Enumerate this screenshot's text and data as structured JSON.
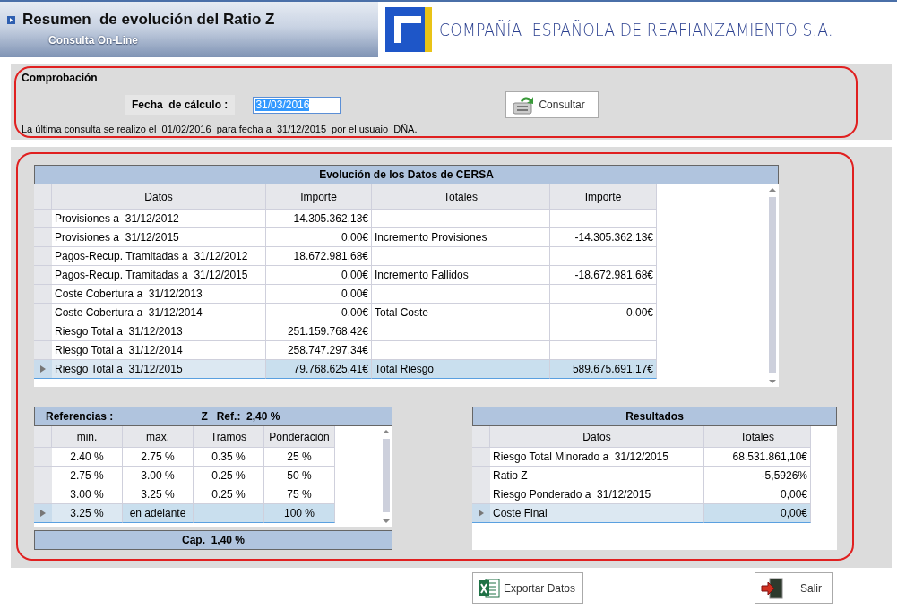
{
  "header": {
    "title": "Resumen  de evolución del Ratio Z",
    "subtitle": "Consulta On-Line",
    "company": "COMPAÑÍA  ESPAÑOLA DE REAFIANZAMIENTO S.A."
  },
  "check": {
    "title": "Comprobación",
    "date_label": "Fecha  de cálculo :",
    "date_value": "31/03/2016",
    "consult_button": "Consultar",
    "last_query": "La última consulta se realizo el  01/02/2016  para fecha a  31/12/2015  por el usuaio  DÑA."
  },
  "evolution": {
    "title": "Evolución de los Datos de CERSA",
    "columns": [
      "Datos",
      "Importe",
      "Totales",
      "Importe"
    ],
    "rows": [
      {
        "cells": [
          "Provisiones a  31/12/2012",
          "14.305.362,13€",
          "",
          ""
        ],
        "selected": false
      },
      {
        "cells": [
          "Provisiones a  31/12/2015",
          "0,00€",
          "Incremento Provisiones",
          "-14.305.362,13€"
        ],
        "selected": false
      },
      {
        "cells": [
          "Pagos-Recup. Tramitadas a  31/12/2012",
          "18.672.981,68€",
          "",
          ""
        ],
        "selected": false
      },
      {
        "cells": [
          "Pagos-Recup. Tramitadas a  31/12/2015",
          "0,00€",
          "Incremento Fallidos",
          "-18.672.981,68€"
        ],
        "selected": false
      },
      {
        "cells": [
          "Coste Cobertura a  31/12/2013",
          "0,00€",
          "",
          ""
        ],
        "selected": false
      },
      {
        "cells": [
          "Coste Cobertura a  31/12/2014",
          "0,00€",
          "Total Coste",
          "0,00€"
        ],
        "selected": false
      },
      {
        "cells": [
          "Riesgo Total a  31/12/2013",
          "251.159.768,42€",
          "",
          ""
        ],
        "selected": false
      },
      {
        "cells": [
          "Riesgo Total a  31/12/2014",
          "258.747.297,34€",
          "",
          ""
        ],
        "selected": false
      },
      {
        "cells": [
          "Riesgo Total a  31/12/2015",
          "79.768.625,41€",
          "Total Riesgo",
          "589.675.691,17€"
        ],
        "selected": true
      }
    ]
  },
  "references": {
    "label": "Referencias :",
    "z_ref": "Z   Ref.:  2,40 %",
    "columns": [
      "min.",
      "max.",
      "Tramos",
      "Ponderación"
    ],
    "rows": [
      {
        "cells": [
          "2.40 %",
          "2.75 %",
          "0.35 %",
          "25 %"
        ],
        "selected": false
      },
      {
        "cells": [
          "2.75 %",
          "3.00 %",
          "0.25 %",
          "50 %"
        ],
        "selected": false
      },
      {
        "cells": [
          "3.00 %",
          "3.25 %",
          "0.25 %",
          "75 %"
        ],
        "selected": false
      },
      {
        "cells": [
          "3.25 %",
          "en adelante",
          "",
          "100 %"
        ],
        "selected": true
      }
    ],
    "cap": "Cap.  1,40 %"
  },
  "results": {
    "title": "Resultados",
    "columns": [
      "Datos",
      "Totales"
    ],
    "rows": [
      {
        "cells": [
          "Riesgo Total Minorado a  31/12/2015",
          "68.531.861,10€"
        ],
        "selected": false
      },
      {
        "cells": [
          "Ratio Z",
          "-5,5926%"
        ],
        "selected": false
      },
      {
        "cells": [
          "Riesgo Ponderado a  31/12/2015",
          "0,00€"
        ],
        "selected": false
      },
      {
        "cells": [
          "Coste Final",
          "0,00€"
        ],
        "selected": true
      }
    ]
  },
  "buttons": {
    "export": "Exportar Datos",
    "exit": "Salir"
  }
}
